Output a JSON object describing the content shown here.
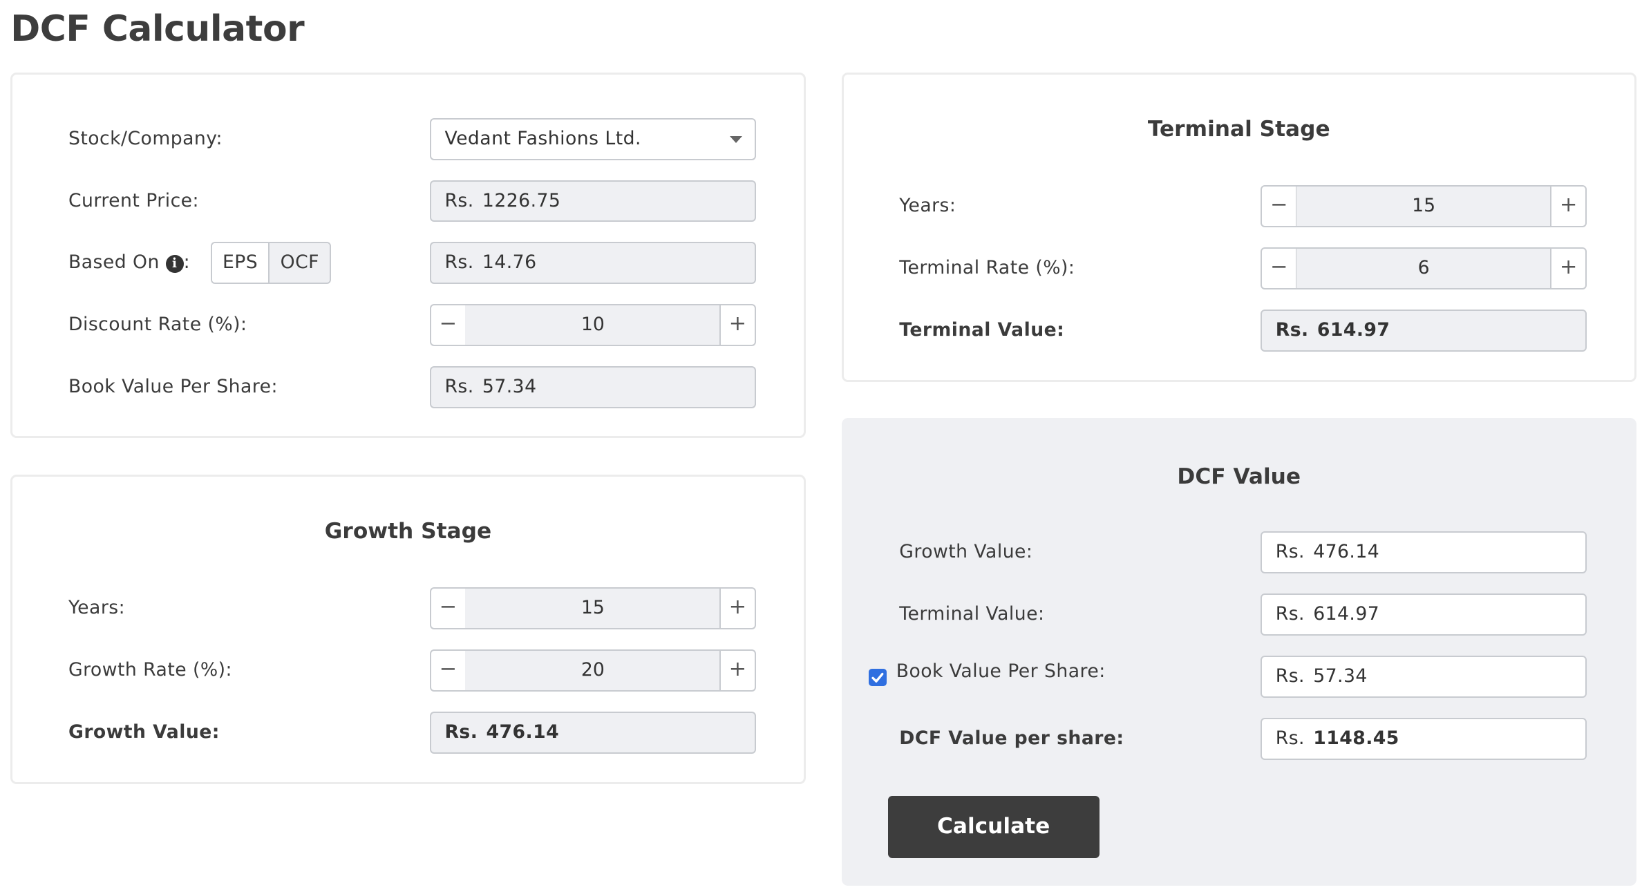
{
  "title": "DCF Calculator",
  "inputs": {
    "stock_label": "Stock/Company:",
    "stock_value": "Vedant Fashions Ltd.",
    "price_label": "Current Price:",
    "price_prefix": "Rs.",
    "price_value": "1226.75",
    "based_on_label": "Based On",
    "based_on_colon": ":",
    "based_on_options": [
      "EPS",
      "OCF"
    ],
    "based_on_selected": "OCF",
    "based_prefix": "Rs.",
    "based_value": "14.76",
    "discount_label": "Discount Rate (%):",
    "discount_value": "10",
    "bvps_label": "Book Value Per Share:",
    "bvps_prefix": "Rs.",
    "bvps_value": "57.34"
  },
  "growth": {
    "title": "Growth Stage",
    "years_label": "Years:",
    "years_value": "15",
    "rate_label": "Growth Rate (%):",
    "rate_value": "20",
    "value_label": "Growth Value:",
    "value_prefix": "Rs.",
    "value_value": "476.14"
  },
  "terminal": {
    "title": "Terminal Stage",
    "years_label": "Years:",
    "years_value": "15",
    "rate_label": "Terminal Rate (%):",
    "rate_value": "6",
    "value_label": "Terminal Value:",
    "value_prefix": "Rs.",
    "value_value": "614.97"
  },
  "dcf": {
    "title": "DCF Value",
    "growth_label": "Growth Value:",
    "growth_prefix": "Rs.",
    "growth_value": "476.14",
    "terminal_label": "Terminal Value:",
    "terminal_prefix": "Rs.",
    "terminal_value": "614.97",
    "bvps_label": "Book Value Per Share:",
    "bvps_checked": true,
    "bvps_prefix": "Rs.",
    "bvps_value": "57.34",
    "per_share_label": "DCF Value per share:",
    "per_share_prefix": "Rs.",
    "per_share_value": "1148.45",
    "calculate_label": "Calculate"
  },
  "stepper": {
    "minus_symbol": "−",
    "plus_symbol": "+"
  },
  "icons": {
    "info": "info-circle-icon",
    "caret": "caret-down-icon",
    "check": "checkbox-checked-icon"
  },
  "colors": {
    "accent_dark": "#3d3d3d",
    "field_bg": "#eff0f3",
    "checkbox": "#2f6fe0"
  }
}
